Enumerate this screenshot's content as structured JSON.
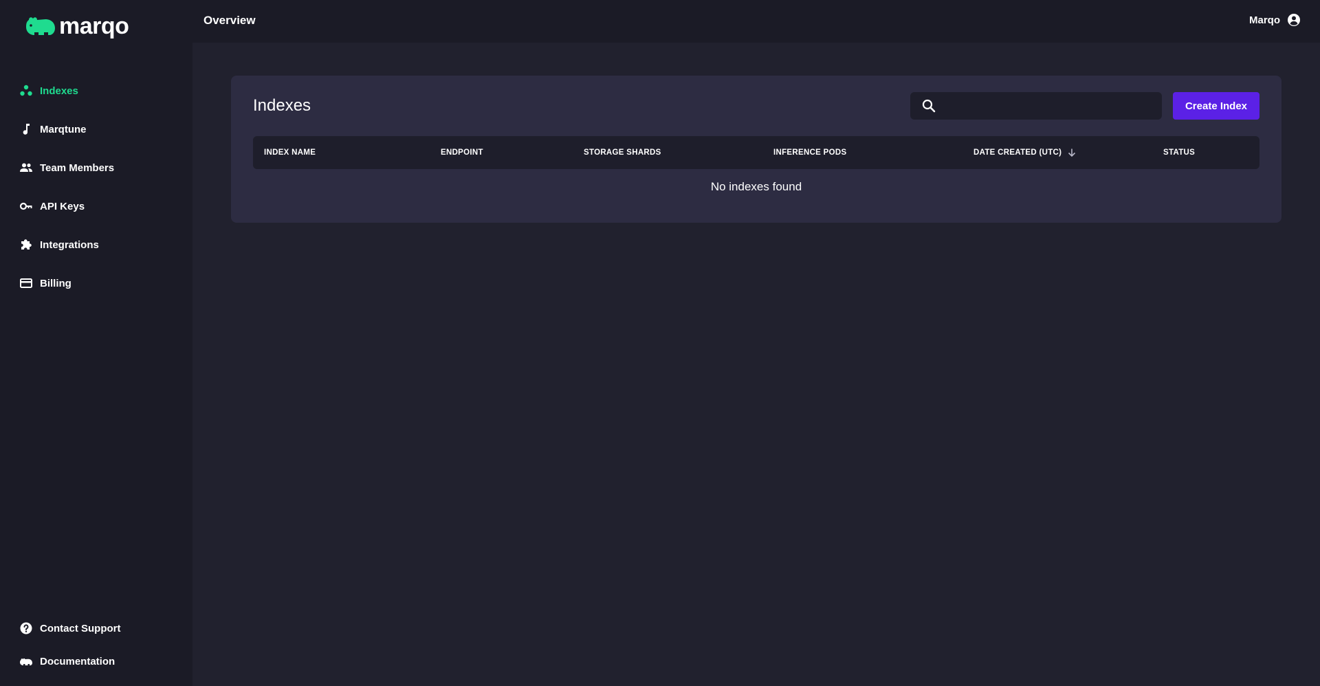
{
  "app": {
    "logo_text": "marqo",
    "brand_color": "#1fdb8f"
  },
  "sidebar": {
    "items": [
      {
        "label": "Indexes",
        "icon": "indexes-icon",
        "active": true
      },
      {
        "label": "Marqtune",
        "icon": "music-note-icon"
      },
      {
        "label": "Team Members",
        "icon": "team-icon"
      },
      {
        "label": "API Keys",
        "icon": "key-icon"
      },
      {
        "label": "Integrations",
        "icon": "puzzle-icon"
      },
      {
        "label": "Billing",
        "icon": "credit-card-icon"
      }
    ],
    "bottom_items": [
      {
        "label": "Contact Support",
        "icon": "help-icon"
      },
      {
        "label": "Documentation",
        "icon": "docs-icon"
      }
    ]
  },
  "header": {
    "title": "Overview",
    "user_name": "Marqo"
  },
  "main": {
    "card_title": "Indexes",
    "search": {
      "value": "",
      "placeholder": ""
    },
    "create_label": "Create Index",
    "create_color": "#5b21e6",
    "columns": [
      "INDEX NAME",
      "ENDPOINT",
      "STORAGE SHARDS",
      "INFERENCE PODS",
      "DATE CREATED (UTC)",
      "STATUS"
    ],
    "sort_column": "DATE CREATED (UTC)",
    "sort_direction": "descending",
    "empty_message": "No indexes found"
  }
}
